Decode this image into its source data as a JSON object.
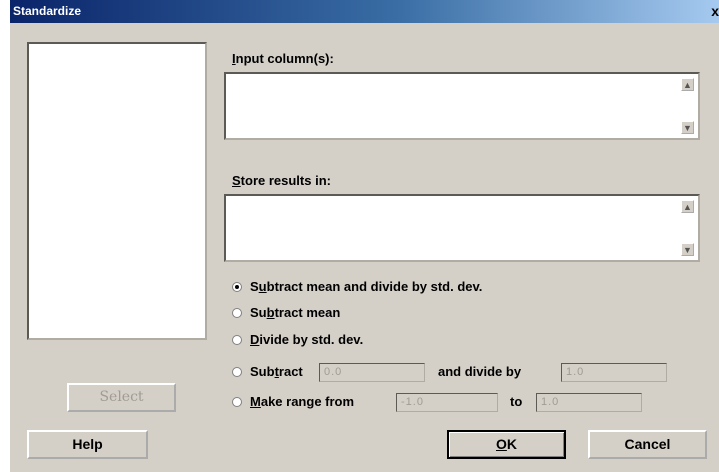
{
  "window": {
    "title": "Standardize",
    "close_glyph": "x"
  },
  "labels": {
    "input_columns": "Input column(s):",
    "input_columns_prefix": "I",
    "input_columns_rest": "nput column(s):",
    "store_results": "Store results in:",
    "store_results_prefix": "S",
    "store_results_rest": "tore results in:"
  },
  "options": {
    "selected": "subtract-mean-divide-std",
    "items": [
      {
        "id": "subtract-mean-divide-std",
        "pre": "S",
        "mn": "u",
        "post": "btract mean and divide by std. dev."
      },
      {
        "id": "subtract-mean",
        "pre": "Su",
        "mn": "b",
        "post": "tract mean"
      },
      {
        "id": "divide-by-std",
        "pre": "",
        "mn": "D",
        "post": "ivide by std. dev."
      },
      {
        "id": "subtract-and-divide",
        "pre": "Sub",
        "mn": "t",
        "post": "ract"
      },
      {
        "id": "make-range",
        "pre": "",
        "mn": "M",
        "post": "ake range from"
      }
    ]
  },
  "fields": {
    "subtract_value": "0.0",
    "and_divide_by_label": "and divide by",
    "divide_value": "1.0",
    "range_from_value": "-1.0",
    "to_label": "to",
    "range_to_value": "1.0"
  },
  "buttons": {
    "select": "Select",
    "help": "Help",
    "ok_mn": "O",
    "ok_rest": "K",
    "cancel": "Cancel"
  },
  "icons": {
    "scroll_up": "▲",
    "scroll_down": "▼"
  }
}
